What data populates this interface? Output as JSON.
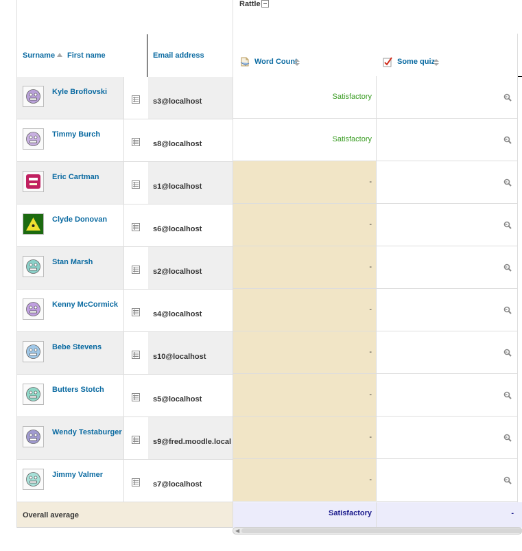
{
  "category": {
    "label": "Rattle"
  },
  "headers": {
    "surname": "Surname",
    "firstname": "First name",
    "email": "Email address",
    "col1": "Word Count",
    "col2": "Some quiz"
  },
  "students": [
    {
      "name": "Kyle Broflovski",
      "email": "s3@localhost",
      "word_count": "Satisfactory",
      "quiz": "-"
    },
    {
      "name": "Timmy Burch",
      "email": "s8@localhost",
      "word_count": "Satisfactory",
      "quiz": "-"
    },
    {
      "name": "Eric Cartman",
      "email": "s1@localhost",
      "word_count": "-",
      "quiz": "-"
    },
    {
      "name": "Clyde Donovan",
      "email": "s6@localhost",
      "word_count": "-",
      "quiz": "-"
    },
    {
      "name": "Stan Marsh",
      "email": "s2@localhost",
      "word_count": "-",
      "quiz": "-"
    },
    {
      "name": "Kenny McCormick",
      "email": "s4@localhost",
      "word_count": "-",
      "quiz": "-"
    },
    {
      "name": "Bebe Stevens",
      "email": "s10@localhost",
      "word_count": "-",
      "quiz": "-"
    },
    {
      "name": "Butters Stotch",
      "email": "s5@localhost",
      "word_count": "-",
      "quiz": "-"
    },
    {
      "name": "Wendy Testaburger",
      "email": "s9@fred.moodle.local",
      "word_count": "-",
      "quiz": "-"
    },
    {
      "name": "Jimmy Valmer",
      "email": "s7@localhost",
      "word_count": "-",
      "quiz": "-"
    }
  ],
  "average": {
    "label": "Overall average",
    "word_count": "Satisfactory",
    "quiz": "-"
  },
  "icons": {
    "sort": "sort-asc-icon",
    "report": "user-report-icon",
    "search": "magnifier-icon",
    "assignment": "assignment-icon",
    "quiz": "quiz-icon",
    "collapse": "collapse-minus-icon"
  },
  "colors": {
    "link": "#0a6aa1",
    "satisfactory": "#399c22",
    "overridden_cell": "#f1e5c6",
    "average_row": "#f3ecdc",
    "average_cell": "#ececfb"
  }
}
